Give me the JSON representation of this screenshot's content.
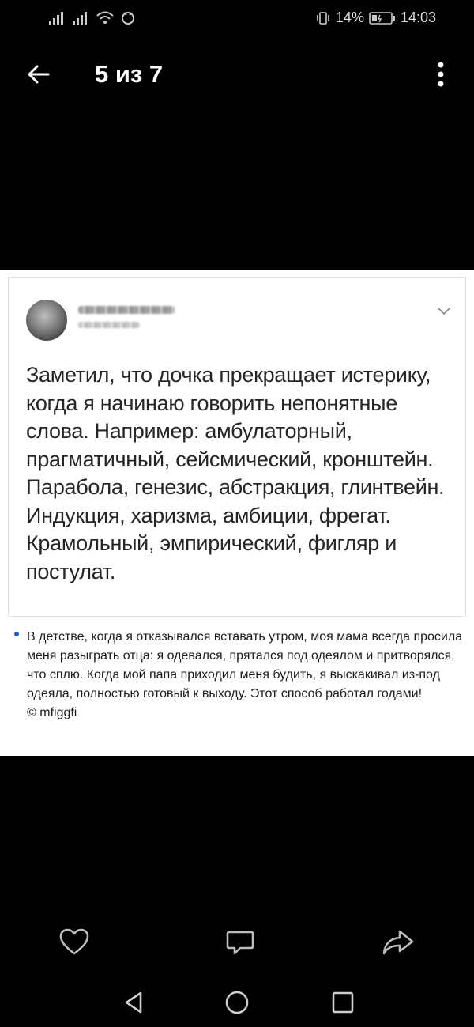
{
  "status_bar": {
    "signal_icons": [
      "signal-1-icon",
      "signal-2-icon",
      "wifi-icon",
      "data-saver-icon"
    ],
    "vibrate_icon": "vibrate-icon",
    "battery_percent": "14%",
    "battery_icon": "battery-low-icon",
    "time": "14:03"
  },
  "app_bar": {
    "back_icon": "arrow-left-icon",
    "counter": "5 из 7",
    "more_icon": "more-vertical-icon"
  },
  "post": {
    "chevron_icon": "chevron-down-icon",
    "text": "Заметил, что дочка прекращает истерику, когда я начинаю говорить непонятные слова. Например: амбулаторный, прагматичный, сейсмический, кронштейн. Парабола, генезис, абстракция, глинтвейн. Индукция, харизма, амбиции, фрегат. Крамольный, эмпирический, фигляр и постулат."
  },
  "caption": {
    "text": "В детстве, когда я отказывался вставать утром, моя мама всегда просила меня разыграть отца: я одевался, прятался под одеялом и притворялся, что сплю. Когда мой папа приходил меня будить, я выскакивал из-под одеяла, полностью готовый к выходу. Этот способ работал годами!",
    "credit": "© mfiggfi"
  },
  "actions": {
    "like_icon": "heart-icon",
    "comment_icon": "comment-icon",
    "share_icon": "share-icon"
  },
  "nav_bar": {
    "back_icon": "nav-back-icon",
    "home_icon": "nav-home-icon",
    "recents_icon": "nav-recents-icon"
  },
  "colors": {
    "background": "#000000",
    "card": "#ffffff",
    "text_dark": "#262626",
    "bullet": "#2b5bb7",
    "icon": "#bdbdbd"
  }
}
